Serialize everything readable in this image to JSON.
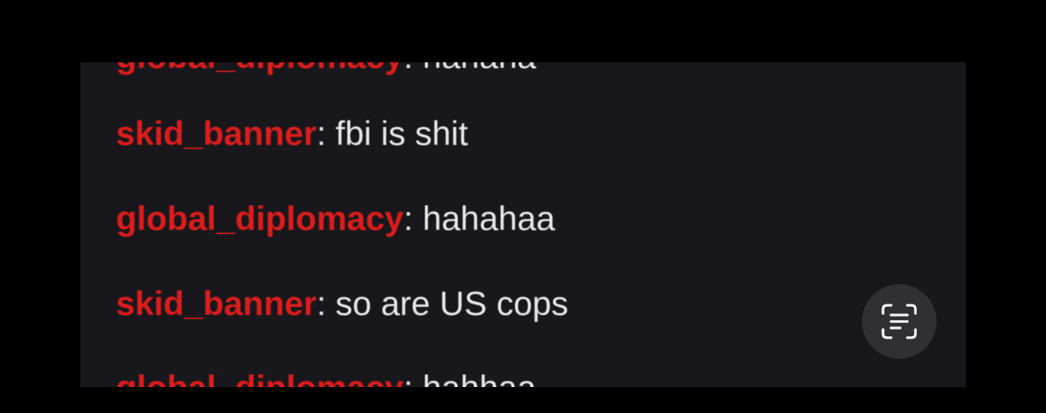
{
  "chat": {
    "messages": [
      {
        "user": "global_diplomacy",
        "separator": ":",
        "text": "hahaha"
      },
      {
        "user": "skid_banner",
        "separator": ":",
        "text": "fbi is shit"
      },
      {
        "user": "global_diplomacy",
        "separator": ":",
        "text": "hahahaa"
      },
      {
        "user": "skid_banner",
        "separator": ":",
        "text": "so are US cops"
      },
      {
        "user": "global_diplomacy",
        "separator": ":",
        "text": "hahhaa"
      }
    ]
  },
  "overlay": {
    "icon": "text-scan-icon"
  },
  "colors": {
    "username": "#dd1c1c",
    "message_text": "#e8e8ea",
    "panel_bg": "#18181c",
    "page_bg": "#000000",
    "button_bg": "#303033"
  }
}
